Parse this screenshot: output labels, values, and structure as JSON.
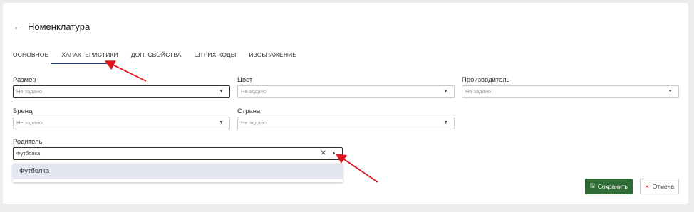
{
  "header": {
    "title": "Номенклатура",
    "back_icon": "arrow-left-icon"
  },
  "tabs": [
    {
      "label": "ОСНОВНОЕ",
      "active": false
    },
    {
      "label": "ХАРАКТЕРИСТИКИ",
      "active": true
    },
    {
      "label": "ДОП. СВОЙСТВА",
      "active": false
    },
    {
      "label": "ШТРИХ-КОДЫ",
      "active": false
    },
    {
      "label": "ИЗОБРАЖЕНИЕ",
      "active": false
    }
  ],
  "fields": {
    "size": {
      "label": "Размер",
      "value": "Не задано"
    },
    "color": {
      "label": "Цвет",
      "value": "Не задано"
    },
    "manufacturer": {
      "label": "Производитель",
      "value": "Не задано"
    },
    "brand": {
      "label": "Бренд",
      "value": "Не задано"
    },
    "country": {
      "label": "Страна",
      "value": "Не задано"
    },
    "parent": {
      "label": "Родитель",
      "value": "Футболка"
    }
  },
  "dropdown": {
    "options": [
      "Футболка"
    ]
  },
  "actions": {
    "save_label": "Сохранить",
    "cancel_label": "Отмена"
  },
  "colors": {
    "accent": "#2b3b73",
    "save": "#2f6c35",
    "annotation": "#e0141e"
  }
}
